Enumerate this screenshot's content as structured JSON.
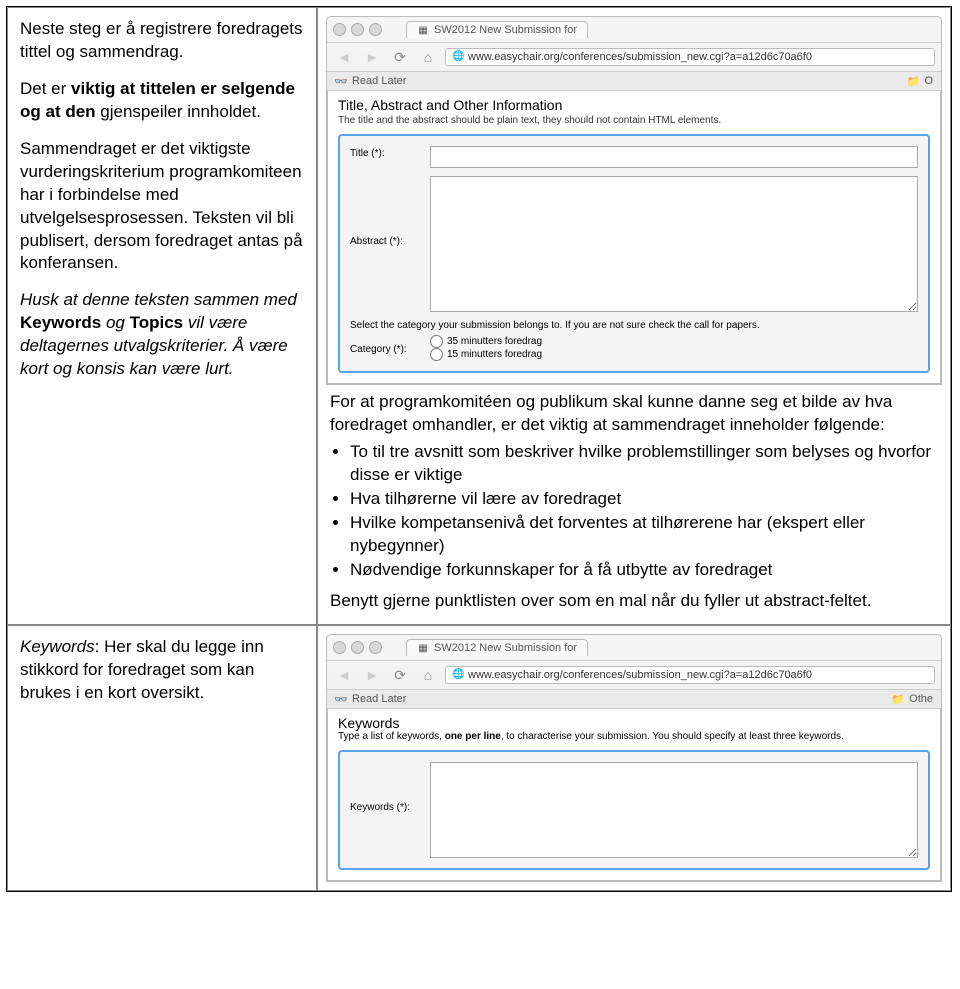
{
  "left1": {
    "p1a": "Neste steg er å registrere foredragets tittel og sammendrag.",
    "p2a": "Det er ",
    "p2b": "viktig at tittelen er selgende og at den",
    "p2c": " gjenspeiler innholdet.",
    "p3": "Sammendraget er det viktigste vurderingskriterium programkomiteen har i forbindelse med utvelgelsesprosessen. Teksten vil bli publisert, dersom foredraget antas på konferansen.",
    "p4a": "Husk at denne teksten sammen med ",
    "p4b": "Keywords",
    "p4c": " og ",
    "p4d": "Topics",
    "p4e": " vil være deltagernes utvalgskriterier. Å være kort og konsis kan være lurt."
  },
  "browser1": {
    "tab_title": "SW2012 New Submission for",
    "url": "www.easychair.org/conferences/submission_new.cgi?a=a12d6c70a6f0",
    "read_later": "Read Later",
    "folder_label": "O"
  },
  "form1": {
    "section_title": "Title, Abstract and Other Information",
    "section_sub": "The title and the abstract should be plain text, they should not contain HTML elements.",
    "title_label": "Title (*):",
    "abstract_label": "Abstract (*):",
    "category_note": "Select the category your submission belongs to. If you are not sure check the call for papers.",
    "category_label": "Category (*):",
    "opt1": "35 minutters foredrag",
    "opt2": "15 minutters foredrag"
  },
  "explain": {
    "intro": "For at programkomitéen og publikum skal kunne danne seg et bilde av hva foredraget omhandler, er det viktig at sammendraget inneholder følgende:",
    "b1": "To til tre avsnitt som beskriver hvilke problemstillinger som belyses og hvorfor disse er viktige",
    "b2": "Hva tilhørerne vil lære av foredraget",
    "b3": "Hvilke kompetansenivå det forventes at tilhørerene har (ekspert eller nybegynner)",
    "b4": "Nødvendige forkunnskaper for å få utbytte av foredraget",
    "outro": "Benytt gjerne punktlisten over som en mal når du fyller ut abstract-feltet."
  },
  "left2": {
    "p1a": "Keywords",
    "p1b": ": Her skal du legge inn stikkord for foredraget som kan brukes i en kort oversikt."
  },
  "browser2": {
    "tab_title": "SW2012 New Submission for",
    "url": "www.easychair.org/conferences/submission_new.cgi?a=a12d6c70a6f0",
    "read_later": "Read Later",
    "folder_label": "Othe"
  },
  "form2": {
    "section_title": "Keywords",
    "note_a": "Type a list of keywords, ",
    "note_b": "one per line",
    "note_c": ", to characterise your submission. You should specify at least three keywords.",
    "keywords_label": "Keywords (*):"
  }
}
